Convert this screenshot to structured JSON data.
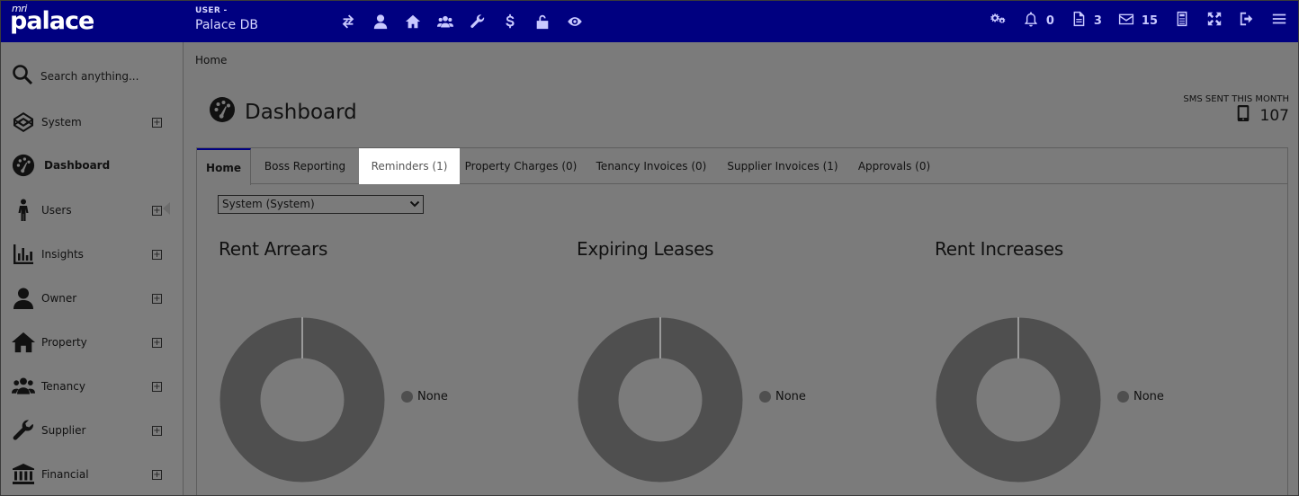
{
  "app": {
    "logo_prefix": "mri",
    "logo_name": "palace"
  },
  "user": {
    "label": "USER -",
    "database": "Palace DB"
  },
  "topbar": {
    "icons": [
      "transfer-icon",
      "user-icon",
      "home-icon",
      "users-group-icon",
      "wrench-icon",
      "dollar-icon",
      "unlock-icon",
      "eye-icon"
    ],
    "right": {
      "settings_icon": "gears-icon",
      "notifications_count": "0",
      "documents_count": "3",
      "messages_count": "15",
      "calculator_icon": "calculator-icon",
      "expand_icon": "expand-icon",
      "logout_icon": "sign-out-icon",
      "menu_icon": "hamburger-icon"
    }
  },
  "sidebar": {
    "search_placeholder": "Search anything...",
    "items": [
      {
        "label": "System",
        "icon": "codepen-icon",
        "expandable": true
      },
      {
        "label": "Dashboard",
        "icon": "dashboard-icon",
        "expandable": false,
        "active": true
      },
      {
        "label": "Users",
        "icon": "person-standing-icon",
        "expandable": true
      },
      {
        "label": "Insights",
        "icon": "bar-chart-icon",
        "expandable": true
      },
      {
        "label": "Owner",
        "icon": "user-icon",
        "expandable": true
      },
      {
        "label": "Property",
        "icon": "home-icon",
        "expandable": true
      },
      {
        "label": "Tenancy",
        "icon": "users-group-icon",
        "expandable": true
      },
      {
        "label": "Supplier",
        "icon": "wrench-icon",
        "expandable": true
      },
      {
        "label": "Financial",
        "icon": "bank-icon",
        "expandable": true
      }
    ],
    "expand_symbol": "+"
  },
  "main": {
    "breadcrumb": "Home",
    "title": "Dashboard",
    "sms": {
      "label": "SMS SENT THIS MONTH",
      "value": "107"
    },
    "tabs": [
      {
        "label": "Home",
        "active": true
      },
      {
        "label": "Boss Reporting"
      },
      {
        "label": "Reminders (1)",
        "highlighted": true
      },
      {
        "label": "Property Charges (0)"
      },
      {
        "label": "Tenancy Invoices (0)"
      },
      {
        "label": "Supplier Invoices (1)"
      },
      {
        "label": "Approvals (0)"
      }
    ],
    "filter": {
      "selected": "System (System)"
    },
    "charts": [
      {
        "title": "Rent Arrears",
        "legend": "None"
      },
      {
        "title": "Expiring Leases",
        "legend": "None"
      },
      {
        "title": "Rent Increases",
        "legend": "None"
      }
    ]
  },
  "colors": {
    "topbar": "#000080",
    "overlay": "#7b7b7b",
    "donut": "#4f4f4f",
    "highlight": "#ffffff"
  }
}
